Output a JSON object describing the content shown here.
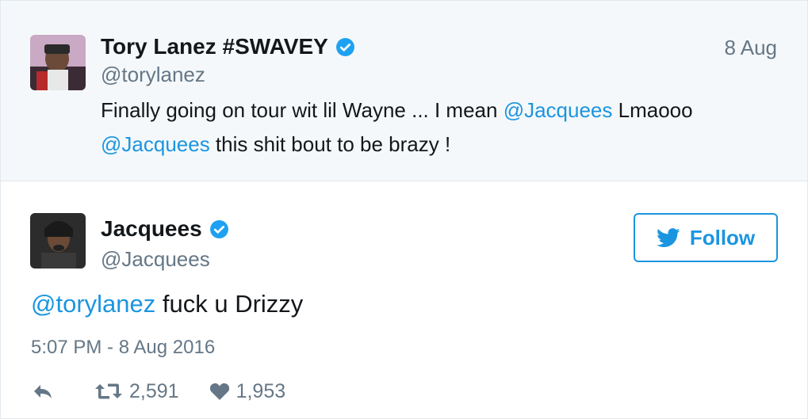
{
  "parent_tweet": {
    "display_name": "Tory Lanez #SWAVEY",
    "handle": "@torylanez",
    "time": "8 Aug",
    "text_part1": "Finally going on tour wit lil Wayne ... I mean ",
    "mention1": "@Jacquees",
    "text_part2": " Lmaooo",
    "mention2": "@Jacquees",
    "text_part3": " this shit bout to be brazy !",
    "avatar_icon": "user-avatar-photo"
  },
  "main_tweet": {
    "display_name": "Jacquees",
    "handle": "@Jacquees",
    "follow_label": "Follow",
    "mention": "@torylanez",
    "text": " fuck u Drizzy",
    "timestamp": "5:07 PM - 8 Aug 2016",
    "retweet_count": "2,591",
    "like_count": "1,953",
    "avatar_icon": "user-avatar-photo"
  },
  "colors": {
    "accent": "#1b95e0",
    "text_muted": "#657786",
    "parent_bg": "#f5f8fa"
  },
  "icons": [
    "verified-badge-icon",
    "twitter-bird-icon",
    "reply-icon",
    "retweet-icon",
    "heart-icon"
  ]
}
